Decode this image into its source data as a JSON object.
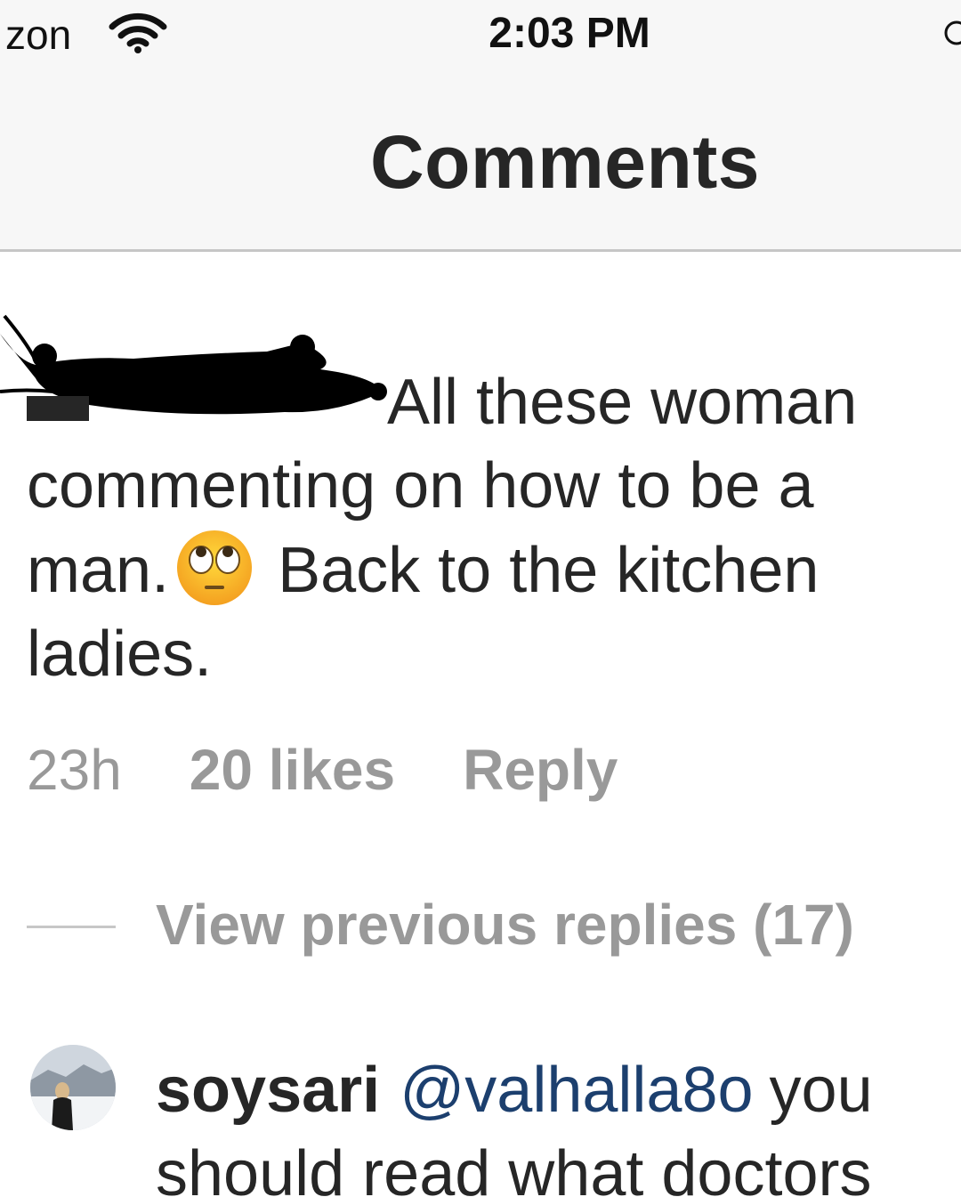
{
  "status_bar": {
    "carrier": "zon",
    "time": "2:03 PM"
  },
  "nav": {
    "title": "Comments"
  },
  "comment": {
    "text_line1": "All these woman",
    "text_line2": "commenting on how to be a",
    "text_line3a": "man.",
    "emoji": "face-with-rolling-eyes",
    "text_line3b": "Back to the kitchen",
    "text_line4": "ladies.",
    "time": "23h",
    "likes": "20 likes",
    "reply": "Reply"
  },
  "replies": {
    "view_previous": "View previous replies (17)"
  },
  "reply_comment": {
    "username": "soysari",
    "mention": "@valhalla8o",
    "text_line1_end": "you",
    "text_line2": "should read what doctors"
  },
  "colors": {
    "mention": "#1c3f6e",
    "meta": "#999999",
    "text": "#262626"
  }
}
